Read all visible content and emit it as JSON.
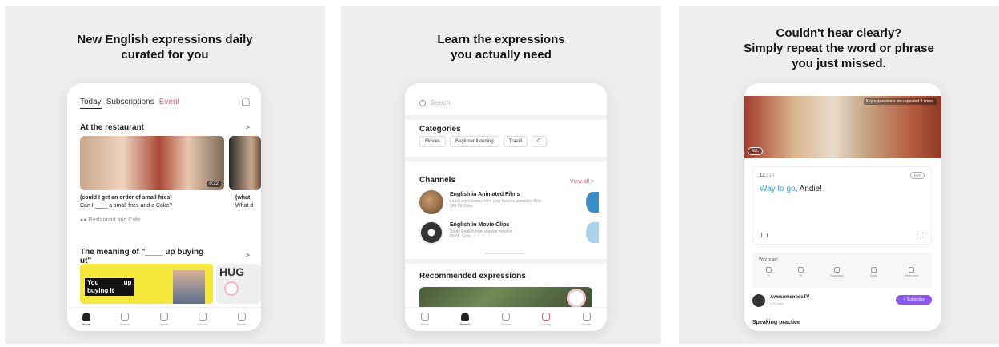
{
  "panels": [
    {
      "headline": "New English expressions daily\ncurated for you",
      "tabs": {
        "today": "Today",
        "subscriptions": "Subscriptions",
        "event": "Event"
      },
      "sections": {
        "restaurant_title": "At the restaurant",
        "meaning_title": "The meaning of \"____ up buying\nut\""
      },
      "cards": [
        {
          "duration": "0:22",
          "title": "(could I get an order of small fries)",
          "subtitle": "Can I ____ a small fries and a Coke?"
        },
        {
          "title": "(what",
          "subtitle": "What d"
        }
      ],
      "tag": "Restaurant and Cafe",
      "caption": "You ______ up\nbuying it",
      "side_caption": "HUG",
      "tabbar": [
        "Home",
        "Search",
        "Speak",
        "Library",
        "Profile"
      ]
    },
    {
      "headline": "Learn the expressions\nyou actually need",
      "search_placeholder": "Search",
      "categories_title": "Categories",
      "categories": [
        "Movies",
        "Beginner listening",
        "Travel",
        "C"
      ],
      "channels_title": "Channels",
      "view_all": "View all >",
      "channels": [
        {
          "title": "English in Animated Films",
          "desc": "Learn expressions from your favorite animated films",
          "subs": "100.5K Subs"
        },
        {
          "title": "English in Movie Clips",
          "desc": "Study English from popular movies!",
          "subs": "80.6K Subs"
        }
      ],
      "recommended_title": "Recommended expressions",
      "tabbar": [
        "Home",
        "Search",
        "Speak",
        "Library",
        "Profile"
      ]
    },
    {
      "headline": "Couldn't hear clearly?\nSimply repeat the word or phrase\nyou just missed.",
      "video_note": "Key expressions are repeated 3 times.",
      "all_button": "ALL",
      "timecode_current": "12",
      "timecode_total": " / 14",
      "pill": "EXP",
      "quote_highlight": "Way to go",
      "quote_rest": ", Andie!",
      "actions_label": "Way to go!",
      "actions": [
        "A",
        "B",
        "Bookmark",
        "Share",
        "Show more"
      ],
      "channel_name": "AwesomenessTV",
      "channel_subs": "97K Subs",
      "subscribe": "+ Subscribe",
      "speaking_title": "Speaking practice"
    }
  ]
}
